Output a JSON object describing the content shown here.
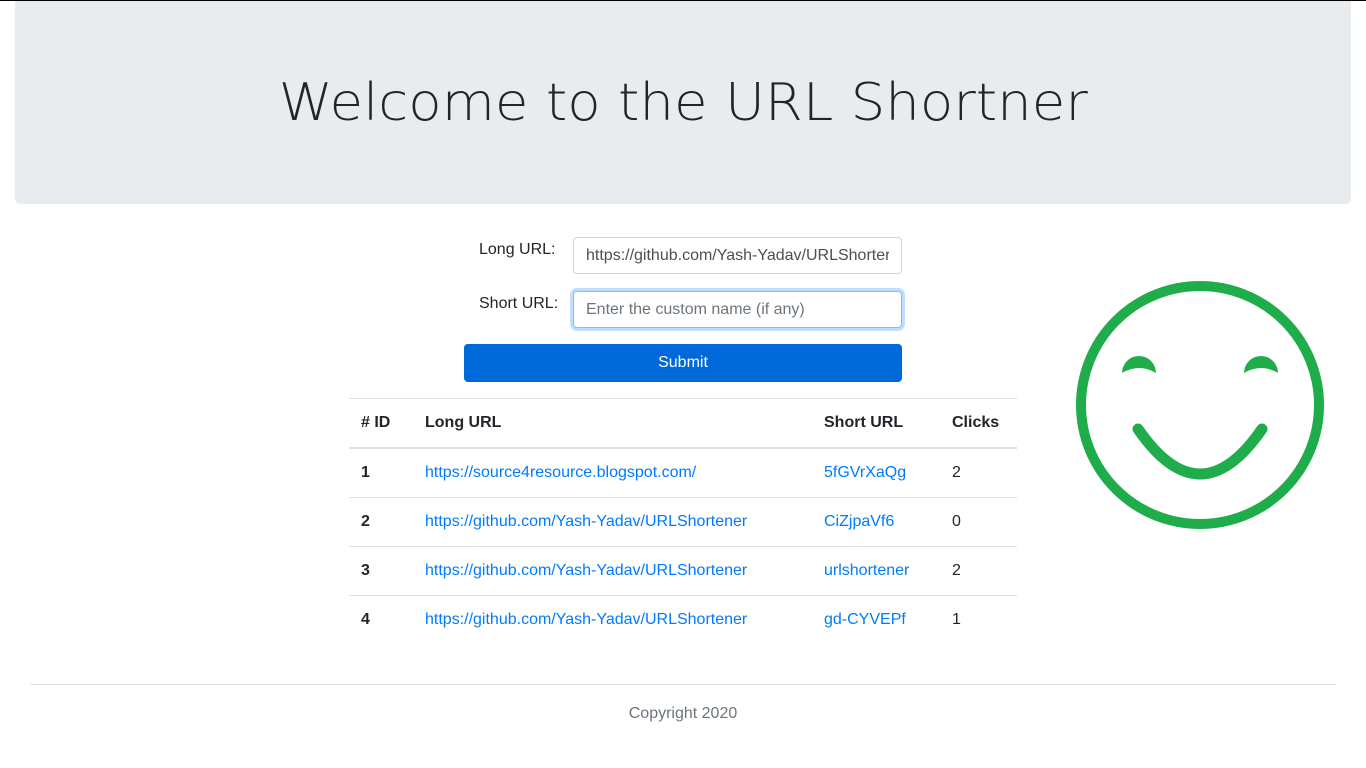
{
  "header": {
    "title": "Welcome to the URL Shortner"
  },
  "form": {
    "long_url_label": "Long URL:",
    "long_url_value": "https://github.com/Yash-Yadav/URLShorter",
    "short_url_label": "Short URL:",
    "short_url_placeholder": "Enter the custom name (if any)",
    "short_url_value": "",
    "submit_label": "Submit"
  },
  "table": {
    "headers": [
      "# ID",
      "Long URL",
      "Short URL",
      "Clicks"
    ],
    "rows": [
      {
        "id": "1",
        "long_url": "https://source4resource.blogspot.com/",
        "short_url": "5fGVrXaQg",
        "clicks": "2"
      },
      {
        "id": "2",
        "long_url": "https://github.com/Yash-Yadav/URLShortener",
        "short_url": "CiZjpaVf6",
        "clicks": "0"
      },
      {
        "id": "3",
        "long_url": "https://github.com/Yash-Yadav/URLShortener",
        "short_url": "urlshortener",
        "clicks": "2"
      },
      {
        "id": "4",
        "long_url": "https://github.com/Yash-Yadav/URLShortener",
        "short_url": "gd-CYVEPf",
        "clicks": "1"
      }
    ]
  },
  "decoration": {
    "icon": "smiley-face-icon",
    "color": "#1fad4b"
  },
  "footer": {
    "copyright": "Copyright 2020"
  },
  "colors": {
    "primary": "#0069d9",
    "link": "#007bff",
    "jumbotron_bg": "#e9ecef"
  }
}
